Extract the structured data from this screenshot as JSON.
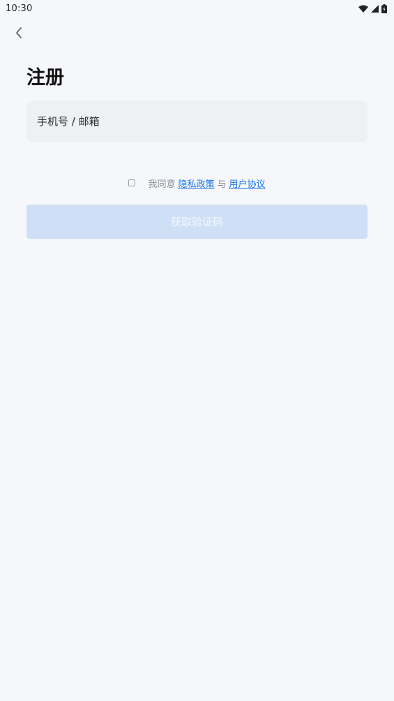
{
  "status_bar": {
    "time": "10:30",
    "icons": [
      "wifi-icon",
      "signal-icon",
      "battery-icon"
    ]
  },
  "nav": {
    "back_icon": "chevron-left-icon"
  },
  "page": {
    "title": "注册"
  },
  "form": {
    "account_placeholder": "手机号 / 邮箱",
    "account_value": ""
  },
  "agreement": {
    "checked": false,
    "prefix": "我同意",
    "privacy_link": "隐私政策",
    "conjunction": "与",
    "terms_link": "用户协议"
  },
  "actions": {
    "get_code_label": "获取验证码",
    "disabled": true
  },
  "colors": {
    "background": "#f5f7fb",
    "input_bg": "#eef0f4",
    "link": "#1a73e8",
    "button_disabled_bg": "#cfe0f6",
    "button_disabled_text": "#f4f8fd"
  }
}
